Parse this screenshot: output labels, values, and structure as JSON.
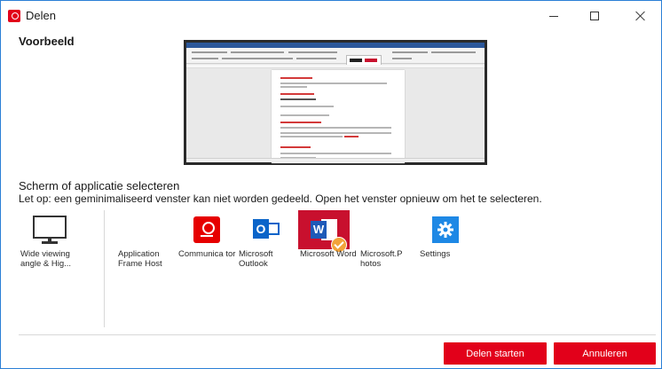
{
  "window": {
    "title": "Delen",
    "app_icon": "vodafone-icon",
    "controls": [
      "minimize-icon",
      "maximize-icon",
      "close-icon"
    ]
  },
  "preview": {
    "label": "Voorbeeld"
  },
  "screen_select": {
    "heading": "Scherm of applicatie selecteren",
    "notice": "Let op: een geminimaliseerd venster kan niet worden gedeeld. Open het venster opnieuw om het te selecteren."
  },
  "sources": [
    {
      "label": "Wide viewing angle & Hig...",
      "icon": "monitor-icon",
      "selected": false
    },
    {
      "label": "Application Frame Host",
      "icon": "none",
      "selected": false
    },
    {
      "label": "Communica tor",
      "icon": "communicator-icon",
      "selected": false
    },
    {
      "label": "Microsoft Outlook",
      "icon": "outlook-icon",
      "selected": false
    },
    {
      "label": "Microsoft Word",
      "icon": "word-icon",
      "selected": true
    },
    {
      "label": "Microsoft.P hotos",
      "icon": "none",
      "selected": false
    },
    {
      "label": "Settings",
      "icon": "settings-gear-icon",
      "selected": false
    }
  ],
  "actions": {
    "start_label": "Delen starten",
    "cancel_label": "Annuleren"
  },
  "colors": {
    "accent": "#e2001a",
    "window_border": "#2b7fd6",
    "selected_check": "#f2a33a"
  }
}
